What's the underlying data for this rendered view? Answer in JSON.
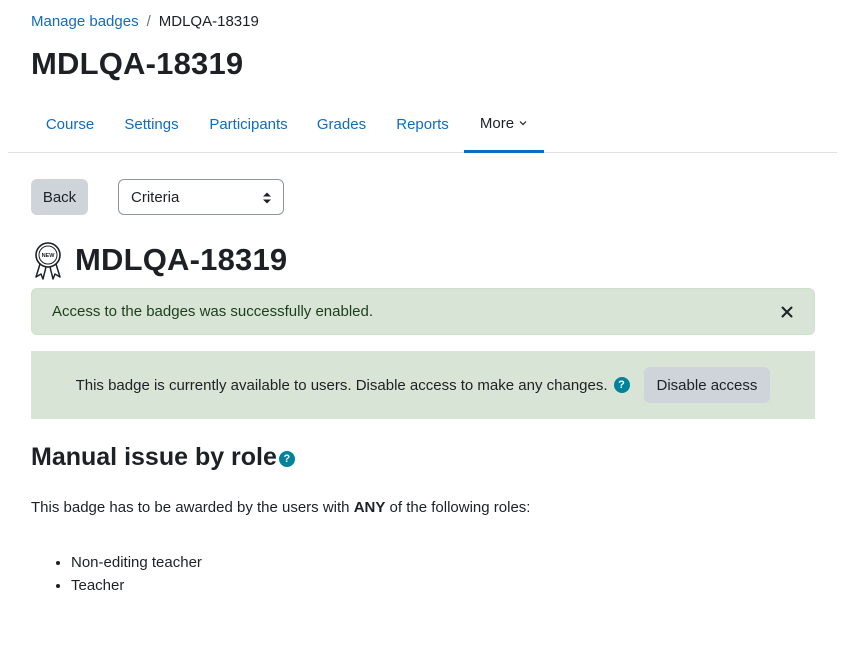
{
  "breadcrumb": {
    "parent": "Manage badges",
    "separator": "/",
    "current": "MDLQA-18319"
  },
  "page_title": "MDLQA-18319",
  "nav_tabs": [
    {
      "label": "Course"
    },
    {
      "label": "Settings"
    },
    {
      "label": "Participants"
    },
    {
      "label": "Grades"
    },
    {
      "label": "Reports"
    },
    {
      "label": "More",
      "active": true
    }
  ],
  "toolbar": {
    "back_label": "Back",
    "select_value": "Criteria"
  },
  "badge": {
    "icon": "badge-medal-icon",
    "icon_text": "NEW",
    "name": "MDLQA-18319"
  },
  "alert": {
    "message": "Access to the badges was successfully enabled.",
    "close_glyph": "×"
  },
  "status": {
    "message": "This badge is currently available to users. Disable access to make any changes.",
    "help_glyph": "?",
    "disable_label": "Disable access"
  },
  "criteria": {
    "heading": "Manual issue by role",
    "help_glyph": "?",
    "desc_before": "This badge has to be awarded by the users with ",
    "desc_emphasis": "ANY",
    "desc_after": " of the following roles:",
    "roles": [
      "Non-editing teacher",
      "Teacher"
    ]
  },
  "colors": {
    "link": "#0f6cbf",
    "success_bg": "#d7e4d6",
    "help_icon": "#00829b",
    "button_bg": "#ced4da"
  }
}
